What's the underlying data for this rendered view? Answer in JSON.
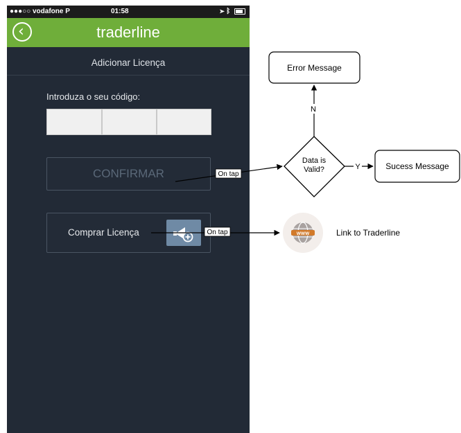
{
  "status_bar": {
    "carrier": "●●●○○ vodafone P",
    "time": "01:58"
  },
  "app": {
    "title": "traderline",
    "subtitle": "Adicionar Licença",
    "code_label": "Introduza o seu código:",
    "confirm_label": "CONFIRMAR",
    "buy_label": "Comprar Licença"
  },
  "diagram": {
    "error_box": "Error Message",
    "no_label": "N",
    "decision_line1": "Data is",
    "decision_line2": "Valid?",
    "yes_label": "Y",
    "success_box": "Sucess Message",
    "on_tap_1": "On tap",
    "on_tap_2": "On tap",
    "web_icon_text": "WWW",
    "link_label": "Link to Traderline"
  },
  "colors": {
    "header_green": "#6fae3a",
    "phone_bg": "#222a36"
  }
}
